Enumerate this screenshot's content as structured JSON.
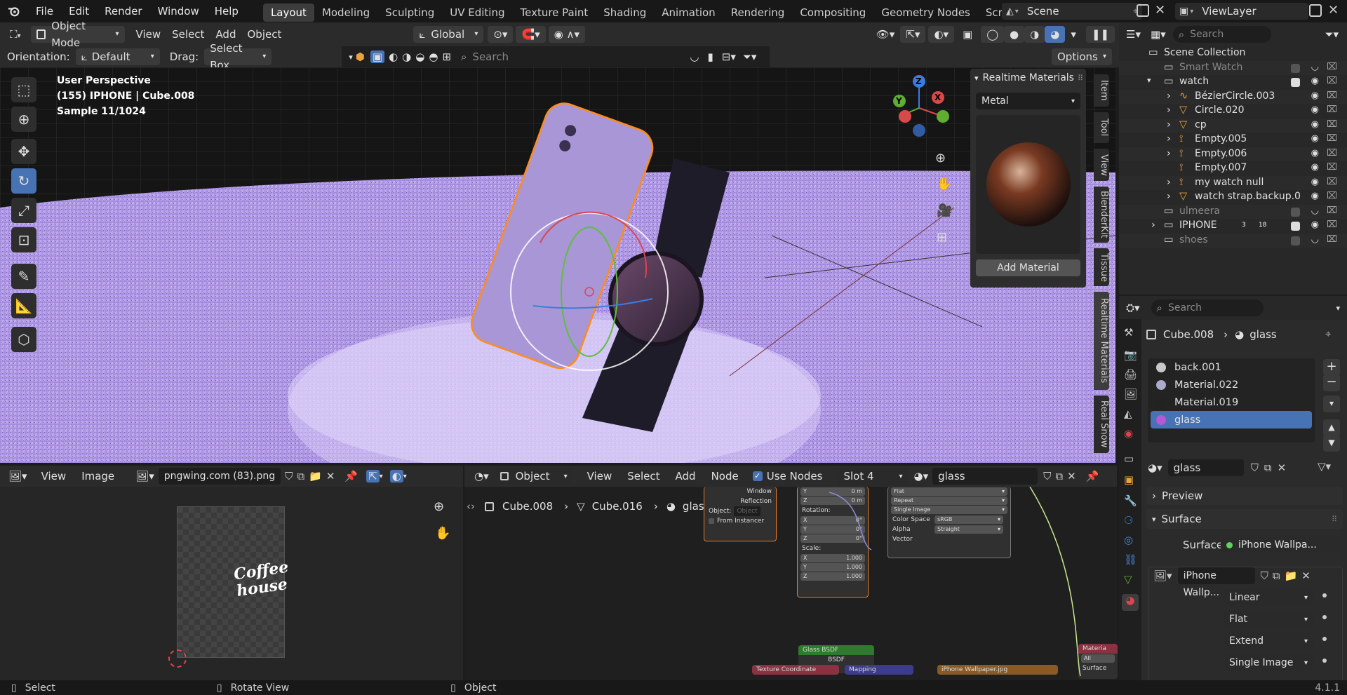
{
  "topbar": {
    "menus": [
      "File",
      "Edit",
      "Render",
      "Window",
      "Help"
    ],
    "workspaces": [
      "Layout",
      "Modeling",
      "Sculpting",
      "UV Editing",
      "Texture Paint",
      "Shading",
      "Animation",
      "Rendering",
      "Compositing",
      "Geometry Nodes",
      "Scripting"
    ],
    "active_workspace": "Layout",
    "add_tab": "+",
    "scene_label": "Scene",
    "viewlayer_label": "ViewLayer"
  },
  "viewport_header": {
    "mode": "Object Mode",
    "menus": [
      "View",
      "Select",
      "Add",
      "Object"
    ],
    "transform_orientation": "Global",
    "orientation_label": "Orientation:",
    "orientation_value": "Default",
    "drag_label": "Drag:",
    "drag_value": "Select Box",
    "search_placeholder": "Search",
    "options_label": "Options"
  },
  "viewport": {
    "line1": "User Perspective",
    "line2": "(155) IPHONE | Cube.008",
    "line3": "Sample 11/1024",
    "gizmo": {
      "z": "Z",
      "y": "Y",
      "x": "X"
    }
  },
  "realtime_panel": {
    "title": "Realtime Materials",
    "dropdown": "Metal",
    "add_button": "Add Material"
  },
  "side_tabs": [
    "Item",
    "Tool",
    "View",
    "BlenderKit",
    "Tissue",
    "Realtime Materials",
    "Real Snow"
  ],
  "outliner": {
    "search_placeholder": "Search",
    "rows": [
      {
        "label": "Scene Collection",
        "indent": 0
      },
      {
        "label": "Smart Watch",
        "indent": 1,
        "dim": true
      },
      {
        "label": "watch",
        "indent": 1
      },
      {
        "label": "BézierCircle.003",
        "indent": 2
      },
      {
        "label": "Circle.020",
        "indent": 2
      },
      {
        "label": "cp",
        "indent": 2
      },
      {
        "label": "Empty.005",
        "indent": 2
      },
      {
        "label": "Empty.006",
        "indent": 2
      },
      {
        "label": "Empty.007",
        "indent": 2
      },
      {
        "label": "my watch null",
        "indent": 2
      },
      {
        "label": "watch strap.backup.0",
        "indent": 2
      },
      {
        "label": "ulmeera",
        "indent": 1,
        "dim": true
      },
      {
        "label": "IPHONE",
        "indent": 1
      },
      {
        "label": "shoes",
        "indent": 1,
        "dim": true
      }
    ],
    "iphone_badges": [
      "3",
      "18"
    ]
  },
  "properties": {
    "search_placeholder": "Search",
    "breadcrumb_object": "Cube.008",
    "breadcrumb_material": "glass",
    "slots": [
      "back.001",
      "Material.022",
      "Material.019",
      "glass"
    ],
    "selected_slot": "glass",
    "material_name": "glass",
    "sections": {
      "preview": "Preview",
      "surface": "Surface"
    },
    "surface_label": "Surface",
    "surface_value": "iPhone Wallpa...",
    "image_name": "iPhone Wallp...",
    "interpolation": "Linear",
    "projection": "Flat",
    "extension": "Extend",
    "source": "Single Image"
  },
  "image_editor": {
    "menus": [
      "View",
      "Image"
    ],
    "image_name": "pngwing.com (83).png",
    "logo_line1": "Coffee",
    "logo_line2": "house"
  },
  "node_editor": {
    "type_label": "Object",
    "menus": [
      "View",
      "Select",
      "Add",
      "Node"
    ],
    "use_nodes_label": "Use Nodes",
    "slot_label": "Slot 4",
    "material_name": "glass",
    "breadcrumb": [
      "Cube.008",
      "Cube.016",
      "glass"
    ],
    "nodes": {
      "texcoord": {
        "outputs": [
          "Window",
          "Reflection"
        ],
        "object_label": "Object:",
        "object_placeholder": "Object",
        "from_instancer": "From Instancer"
      },
      "mapping": {
        "y_loc": "0 m",
        "z_loc": "0 m",
        "rotation_label": "Rotation:",
        "rot_x": "0°",
        "rot_y": "0°",
        "rot_z": "0°",
        "scale_label": "Scale:",
        "scale_x": "1.000",
        "scale_y": "1.000",
        "scale_z": "1.000"
      },
      "image": {
        "projection": "Flat",
        "extension": "Repeat",
        "source": "Single Image",
        "color_space_label": "Color Space",
        "color_space": "sRGB",
        "alpha_label": "Alpha",
        "alpha": "Straight",
        "vector_label": "Vector"
      },
      "glass_bsdf": {
        "title": "Glass BSDF",
        "output": "BSDF"
      },
      "texcoord_title": "Texture Coordinate",
      "mapping_title": "Mapping",
      "image_title": "iPhone Wallpaper.jpg",
      "output": {
        "title": "Materia",
        "all": "All",
        "surface": "Surface"
      }
    }
  },
  "statusbar": {
    "select": "Select",
    "rotate": "Rotate View",
    "object": "Object",
    "version": "4.1.1"
  },
  "colors": {
    "accent": "#4772b3",
    "selection_orange": "#ff8c1a",
    "floor_purple": "#b49ce6"
  }
}
